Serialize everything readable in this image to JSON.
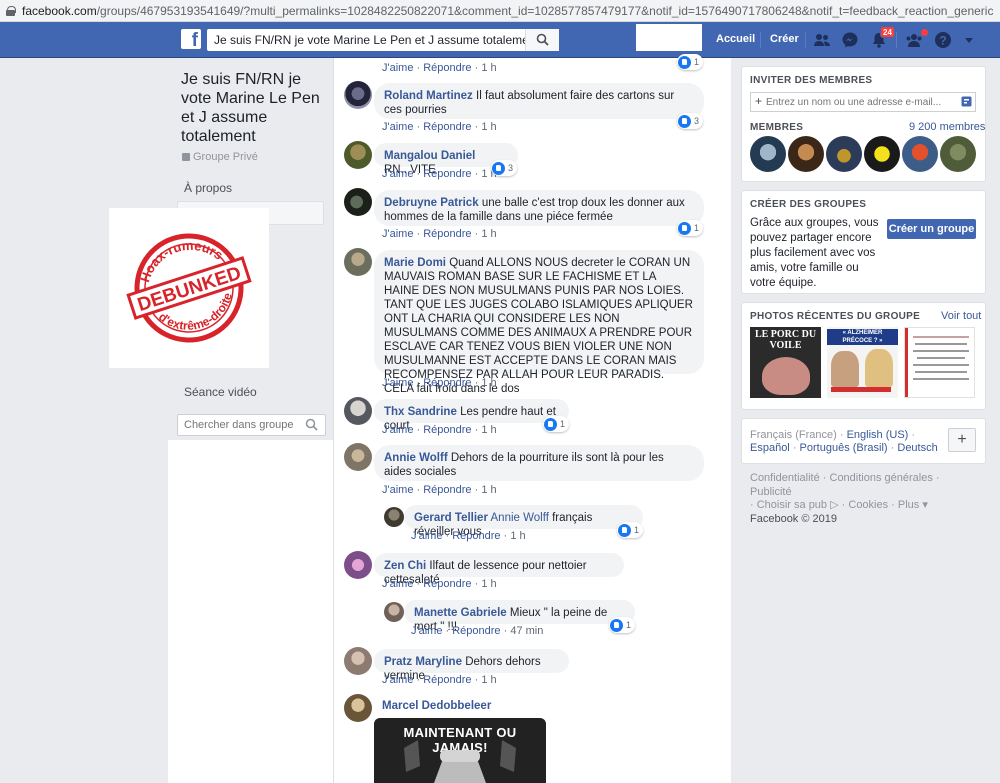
{
  "browser": {
    "url_host": "facebook.com",
    "url_path": "/groups/467953193541649/?multi_permalinks=1028482250822071&comment_id=1028577857479177&notif_id=1576490717806248&notif_t=feedback_reaction_generic"
  },
  "topbar": {
    "logo": "f",
    "search_value": "Je suis FN/RN je vote Marine Le Pen et J assume totalement",
    "home": "Accueil",
    "create": "Créer",
    "notification_count": "24",
    "icons": [
      "friends-icon",
      "messenger-icon",
      "notifications-icon",
      "group-requests-icon",
      "help-icon",
      "dropdown-icon"
    ]
  },
  "left": {
    "group_name": "Je suis FN/RN je vote Marine Le Pen et J assume totalement",
    "privacy": "Groupe Privé",
    "about": "À propos",
    "partial_item": "Membres",
    "video": "Séance vidéo",
    "search_placeholder": "Chercher dans groupe"
  },
  "overlay": {
    "line1": "Hoax-rumeurs",
    "stamp": "DEBUNKED",
    "line2": "d'extrême-droite",
    "color": "#d8232a"
  },
  "comments": {
    "c0": {
      "like": "J'aime",
      "reply": "Répondre",
      "time": "1 h",
      "reactions": "1"
    },
    "c1": {
      "author": "Roland Martinez",
      "text": "Il faut absolument faire des cartons sur ces pourries",
      "like": "J'aime",
      "reply": "Répondre",
      "time": "1 h",
      "reactions": "3"
    },
    "c2": {
      "author": "Mangalou Daniel",
      "text": "RN...VITE",
      "like": "J'aime",
      "reply": "Répondre",
      "time": "1 h",
      "reactions": "3"
    },
    "c3": {
      "author": "Debruyne Patrick",
      "text": "une balle c'est trop doux les donner aux hommes de la famille dans une piéce fermée",
      "like": "J'aime",
      "reply": "Répondre",
      "time": "1 h",
      "reactions": "1"
    },
    "c4": {
      "author": "Marie Domi",
      "text": "Quand ALLONS NOUS decreter le CORAN UN MAUVAIS ROMAN BASE SUR LE FACHISME ET LA HAINE DES NON MUSULMANS PUNIS PAR NOS LOIES. TANT QUE LES JUGES COLABO ISLAMIQUES APLIQUER ONT LA CHARIA QUI CONSIDERE LES NON MUSULMANS COMME DES ANIMAUX A PRENDRE POUR ESCLAVE CAR TENEZ VOUS BIEN VIOLER UNE NON MUSULMANNE EST ACCEPTE DANS LE CORAN MAIS RECOMPENSEZ PAR ALLAH POUR LEUR PARADIS. CELA fait froid dans le dos",
      "like": "J'aime",
      "reply": "Répondre",
      "time": "1 h"
    },
    "c5": {
      "author": "Thx Sandrine",
      "text": "Les pendre haut et court",
      "like": "J'aime",
      "reply": "Répondre",
      "time": "1 h",
      "reactions": "1"
    },
    "c6": {
      "author": "Annie Wolff",
      "text": "Dehors de la pourriture ils sont là pour les aides sociales",
      "like": "J'aime",
      "reply": "Répondre",
      "time": "1 h"
    },
    "c6r": {
      "author": "Gerard Tellier",
      "mention": "Annie Wolff",
      "text": "français réveiller vous",
      "like": "J'aime",
      "reply": "Répondre",
      "time": "1 h",
      "reactions": "1"
    },
    "c7": {
      "author": "Zen Chi",
      "text": "Ilfaut de lessence pour nettoier cettesaleté",
      "like": "J'aime",
      "reply": "Répondre",
      "time": "1 h"
    },
    "c7r": {
      "author": "Manette Gabriele",
      "text": "Mieux \" la peine de mort \" !!!",
      "like": "J'aime",
      "reply": "Répondre",
      "time": "47 min",
      "reactions": "1"
    },
    "c8": {
      "author": "Pratz Maryline",
      "text": "Dehors dehors vermine",
      "like": "J'aime",
      "reply": "Répondre",
      "time": "1 h"
    },
    "c9": {
      "author": "Marcel Dedobbeleer",
      "image_text": "MAINTENANT OU JAMAIS!"
    }
  },
  "right": {
    "invite_title": "INVITER DES MEMBRES",
    "invite_placeholder": "Entrez un nom ou une adresse e-mail...",
    "members_title": "MEMBRES",
    "members_count": "9 200 membres",
    "create_title": "CRÉER DES GROUPES",
    "create_text": "Grâce aux groupes, vous pouvez partager encore plus facilement avec vos amis, votre famille ou votre équipe.",
    "create_button": "Créer un groupe",
    "photos_title": "PHOTOS RÉCENTES DU GROUPE",
    "photos_link": "Voir tout",
    "photo1_text": "LE PORC DU VOILE",
    "photo2_text": "« ALZHEIMER PRÉCOCE ? »",
    "lang_current": "Français (France)",
    "lang_1": "English (US)",
    "lang_2": "Español",
    "lang_3": "Português (Brasil)",
    "lang_4": "Deutsch",
    "footer_1": "Confidentialité",
    "footer_2": "Conditions générales",
    "footer_3": "Publicité",
    "footer_4": "Choisir sa pub",
    "footer_5": "Cookies",
    "footer_6": "Plus",
    "copyright": "Facebook © 2019"
  }
}
